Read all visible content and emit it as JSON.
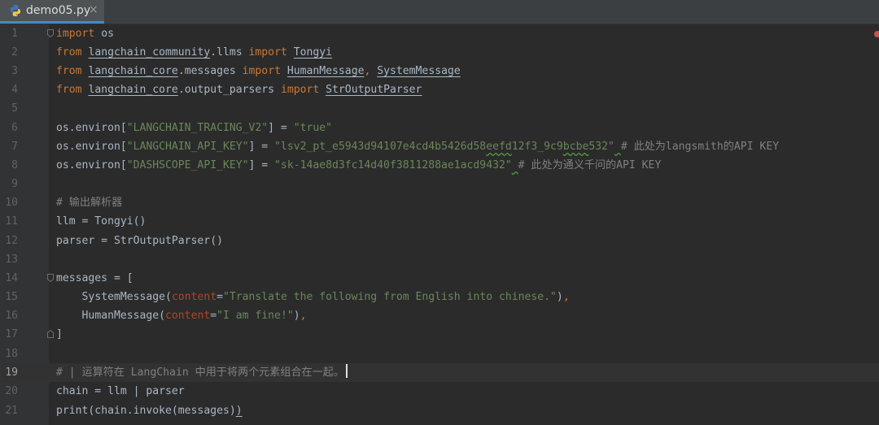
{
  "tab": {
    "filename": "demo05.py",
    "close": "×",
    "icon": "python-file-icon"
  },
  "editor": {
    "current_line": "19",
    "line_numbers": [
      "1",
      "2",
      "3",
      "4",
      "5",
      "6",
      "7",
      "8",
      "9",
      "10",
      "11",
      "12",
      "13",
      "14",
      "15",
      "16",
      "17",
      "18",
      "19",
      "20",
      "21"
    ]
  },
  "code": {
    "l1": {
      "kw": "import",
      "rest": " os"
    },
    "l2": {
      "kw1": "from",
      "mod": "langchain_community",
      "mod2": ".llms ",
      "kw2": "import",
      "name": "Tongyi"
    },
    "l3": {
      "kw1": "from",
      "mod": "langchain_core",
      "mod2": ".messages ",
      "kw2": "import",
      "name1": "HumanMessage",
      "comma": ", ",
      "name2": "SystemMessage"
    },
    "l4": {
      "kw1": "from",
      "mod": "langchain_core",
      "mod2": ".output_parsers ",
      "kw2": "import",
      "name": "StrOutputParser"
    },
    "l6": {
      "pre": "os.environ[",
      "key": "\"LANGCHAIN_TRACING_V2\"",
      "mid": "] = ",
      "val": "\"true\""
    },
    "l7": {
      "pre": "os.environ[",
      "key": "\"LANGCHAIN_API_KEY\"",
      "mid": "] = ",
      "val1": "\"lsv2_pt_e5943d94107e4cd4b5426d58",
      "sq1": "eefd",
      "val2": "12f3_9c9",
      "sq2": "bcbe",
      "val3": "532\"",
      "sp": " ",
      "cmt": "# 此处为langsmith的API KEY"
    },
    "l8": {
      "pre": "os.environ[",
      "key": "\"DASHSCOPE_API_KEY\"",
      "mid": "] = ",
      "val": "\"sk-14ae8d3fc14d40f3811288ae1acd9432\"",
      "sp": " ",
      "cmt": "# 此处为通义千问的API KEY"
    },
    "l10": {
      "cmt": "# 输出解析器"
    },
    "l11": {
      "text": "llm = Tongyi()"
    },
    "l12": {
      "text": "parser = StrOutputParser()"
    },
    "l14": {
      "text": "messages = ["
    },
    "l15": {
      "indent": "    ",
      "fn": "SystemMessage(",
      "param": "content",
      "eq": "=",
      "str": "\"Translate the following from English into chinese.\"",
      "end": ")",
      "comma": ","
    },
    "l16": {
      "indent": "    ",
      "fn": "HumanMessage(",
      "param": "content",
      "eq": "=",
      "str": "\"I am fine!\"",
      "end": ")",
      "comma": ","
    },
    "l17": {
      "text": "]"
    },
    "l19": {
      "cmt": "# | 运算符在 LangChain 中用于将两个元素组合在一起。"
    },
    "l20": {
      "text": "chain = llm | parser"
    },
    "l21": {
      "fn": "print",
      "rest": "(chain.invoke(messages)",
      "last": ")"
    }
  },
  "colors": {
    "background": "#2b2b2b",
    "keyword": "#cc7832",
    "string": "#6a8759",
    "comment": "#808080",
    "default": "#a9b7c6",
    "param": "#aa4926",
    "error_marker": "#c75450"
  }
}
